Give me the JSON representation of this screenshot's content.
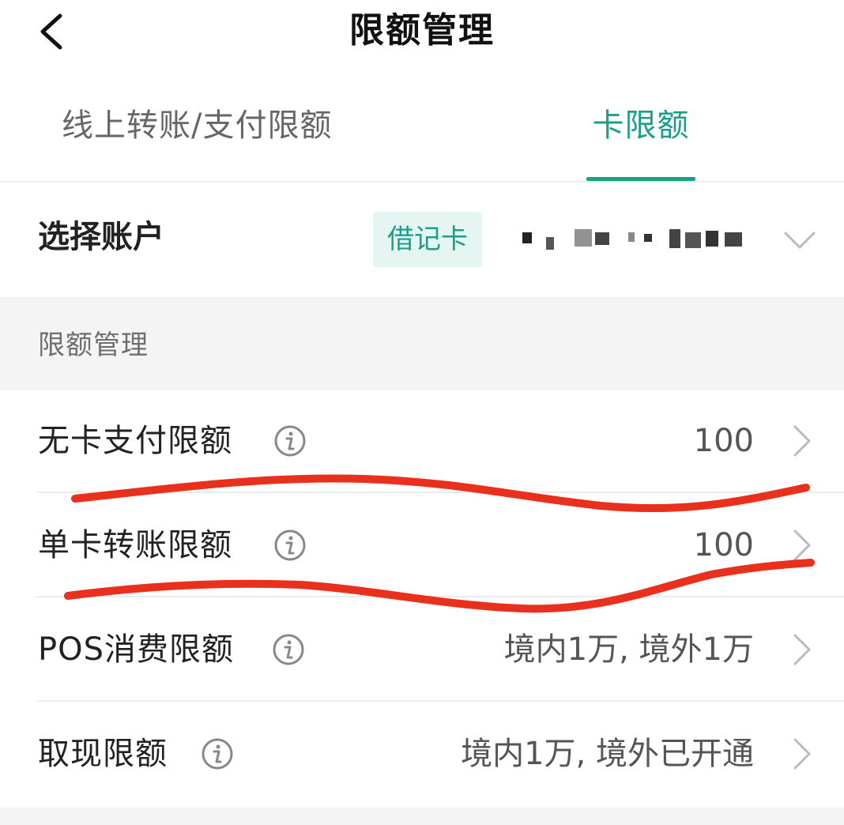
{
  "header": {
    "title": "限额管理",
    "back_icon": "chevron-left-icon"
  },
  "tabs": [
    {
      "label": "线上转账/支付限额",
      "active": false
    },
    {
      "label": "卡限额",
      "active": true
    }
  ],
  "account": {
    "label": "选择账户",
    "badge": "借记卡",
    "dropdown_icon": "chevron-down-icon"
  },
  "section": {
    "title": "限额管理"
  },
  "rows": [
    {
      "label": "无卡支付限额",
      "value": "100",
      "info_icon": "info-icon",
      "chevron_icon": "chevron-right-icon"
    },
    {
      "label": "单卡转账限额",
      "value": "100",
      "info_icon": "info-icon",
      "chevron_icon": "chevron-right-icon"
    },
    {
      "label": "POS消费限额",
      "value": "境内1万, 境外1万",
      "info_icon": "info-icon",
      "chevron_icon": "chevron-right-icon"
    },
    {
      "label": "取现限额",
      "value": "境内1万, 境外已开通",
      "info_icon": "info-icon",
      "chevron_icon": "chevron-right-icon"
    }
  ],
  "colors": {
    "accent": "#1aa089",
    "badge_bg": "#e5f5f1",
    "section_bg": "#f4f4f4",
    "scribble": "#e8301c"
  }
}
